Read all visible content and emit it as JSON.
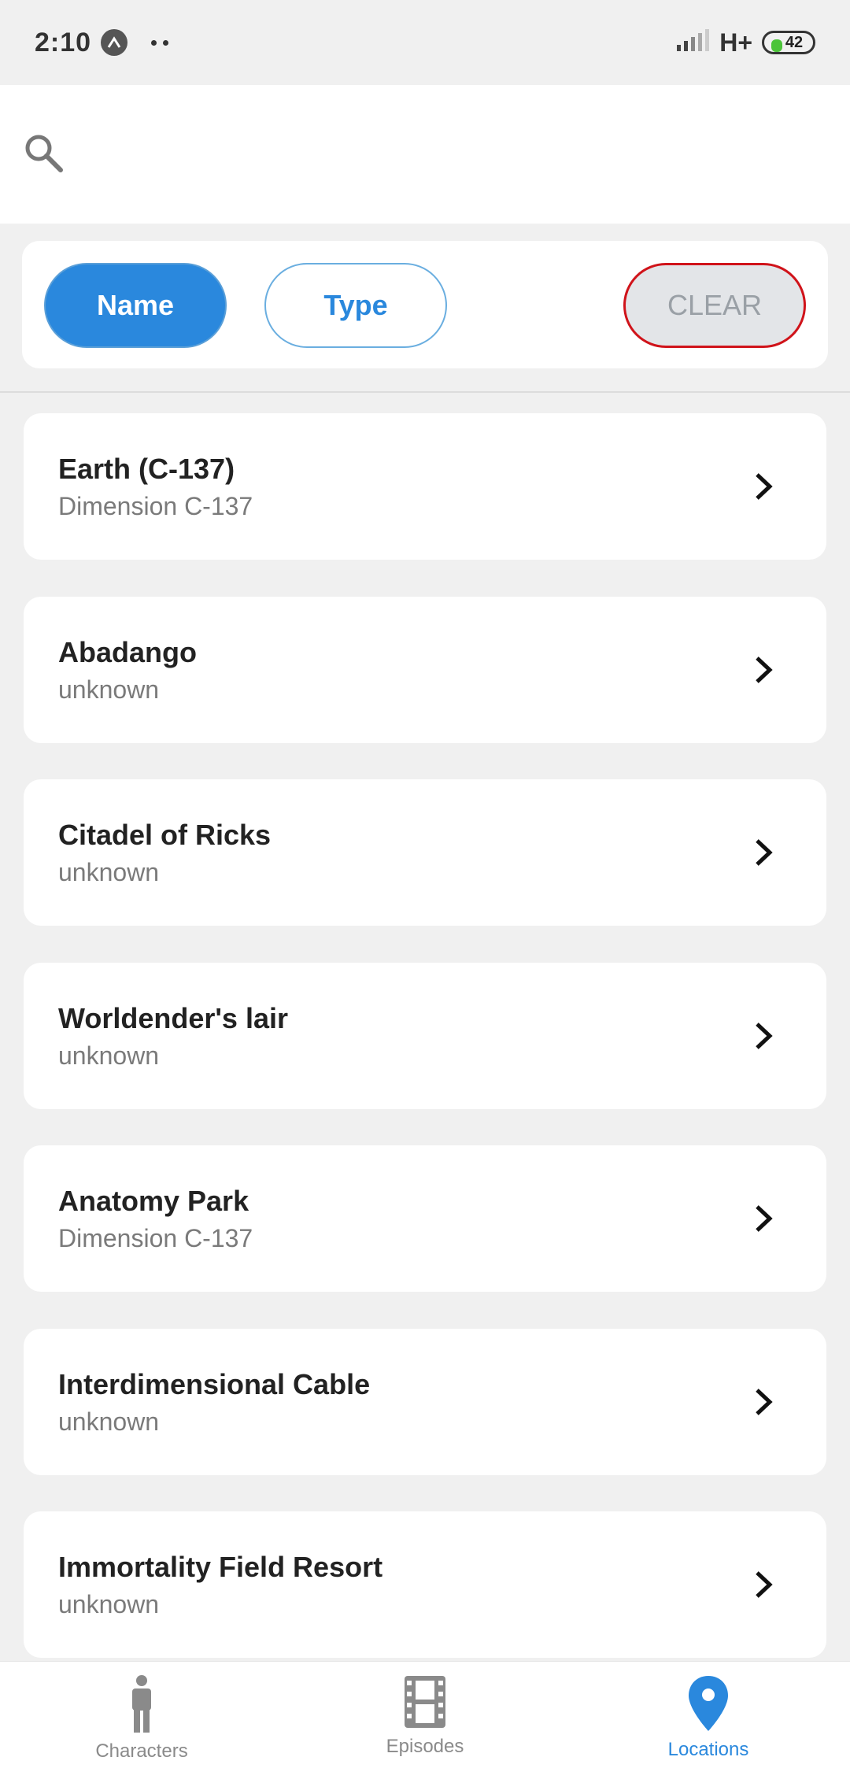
{
  "status_bar": {
    "time": "2:10",
    "network": "H+",
    "battery": "42"
  },
  "search": {
    "value": "",
    "placeholder": ""
  },
  "filters": {
    "name_label": "Name",
    "type_label": "Type",
    "clear_label": "CLEAR",
    "active": "Name"
  },
  "locations": [
    {
      "name": "Earth (C-137)",
      "dimension": "Dimension C-137"
    },
    {
      "name": "Abadango",
      "dimension": "unknown"
    },
    {
      "name": "Citadel of Ricks",
      "dimension": "unknown"
    },
    {
      "name": "Worldender's lair",
      "dimension": "unknown"
    },
    {
      "name": "Anatomy Park",
      "dimension": "Dimension C-137"
    },
    {
      "name": "Interdimensional Cable",
      "dimension": "unknown"
    },
    {
      "name": "Immortality Field Resort",
      "dimension": "unknown"
    }
  ],
  "bottom_nav": {
    "tabs": [
      {
        "label": "Characters",
        "icon": "person-icon"
      },
      {
        "label": "Episodes",
        "icon": "film-icon"
      },
      {
        "label": "Locations",
        "icon": "location-pin-icon"
      }
    ],
    "active_tab": "Locations"
  },
  "colors": {
    "accent": "#2a88dd",
    "clear_border": "#d0131a",
    "background": "#f0f0f0"
  }
}
